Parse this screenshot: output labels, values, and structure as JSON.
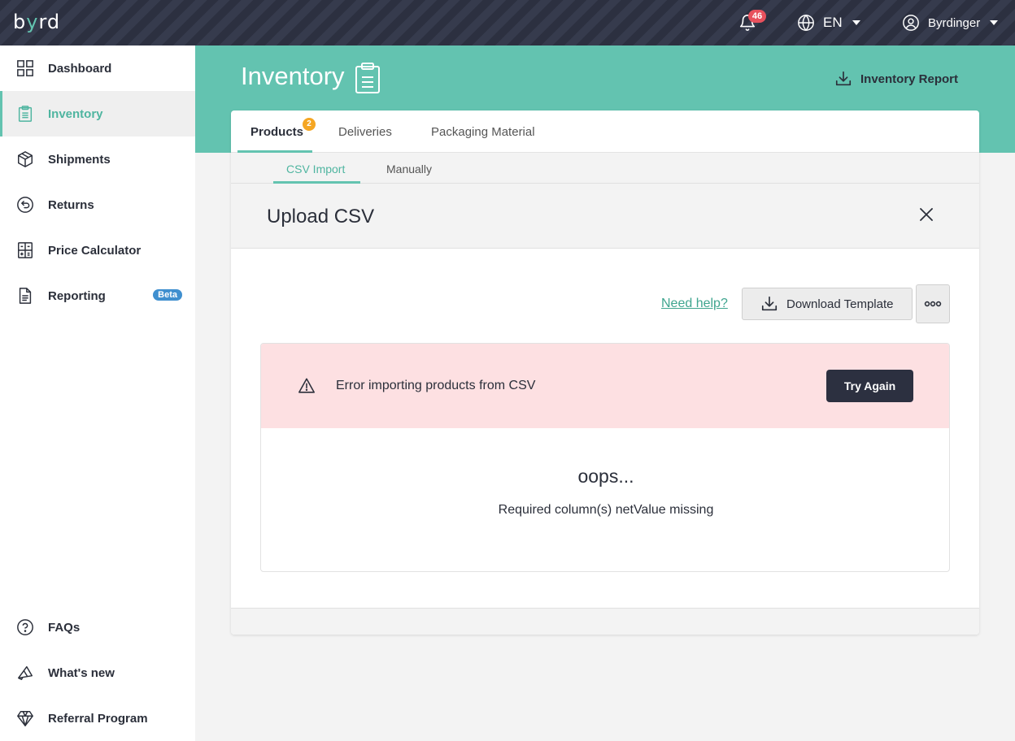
{
  "topbar": {
    "logo": "byrd",
    "notifications_count": "46",
    "language": "EN",
    "user_name": "Byrdinger"
  },
  "sidebar": {
    "items": [
      {
        "label": "Dashboard",
        "icon": "grid-icon"
      },
      {
        "label": "Inventory",
        "icon": "clipboard-icon"
      },
      {
        "label": "Shipments",
        "icon": "package-icon"
      },
      {
        "label": "Returns",
        "icon": "return-icon"
      },
      {
        "label": "Price Calculator",
        "icon": "calculator-icon"
      },
      {
        "label": "Reporting",
        "icon": "document-icon",
        "badge": "Beta"
      }
    ],
    "bottom_items": [
      {
        "label": "FAQs",
        "icon": "question-icon"
      },
      {
        "label": "What's new",
        "icon": "megaphone-icon"
      },
      {
        "label": "Referral Program",
        "icon": "diamond-icon"
      }
    ]
  },
  "header": {
    "title": "Inventory",
    "report_label": "Inventory Report"
  },
  "tabs": {
    "items": [
      "Products",
      "Deliveries",
      "Packaging Material"
    ],
    "products_badge": "2"
  },
  "subtabs": [
    "CSV Import",
    "Manually"
  ],
  "upload": {
    "title": "Upload CSV",
    "help_link": "Need help?",
    "download_label": "Download Template",
    "error_text": "Error importing products from CSV",
    "retry_label": "Try Again",
    "oops": "oops...",
    "message": "Required column(s) netValue missing"
  },
  "colors": {
    "accent": "#63c3b0",
    "dark": "#2c3040",
    "error_bg": "#fde0e2",
    "badge_red": "#e8515d",
    "badge_orange": "#f5a623",
    "beta_blue": "#3f8fcf"
  }
}
